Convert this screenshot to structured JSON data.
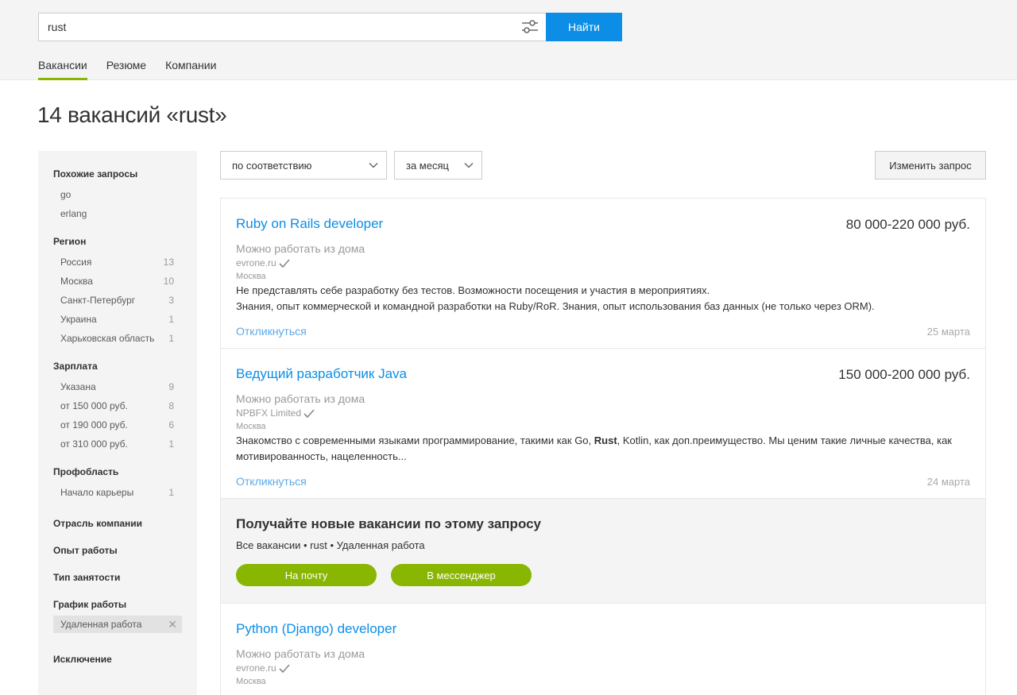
{
  "search": {
    "value": "rust",
    "button_label": "Найти"
  },
  "tabs": [
    {
      "label": "Вакансии",
      "active": true
    },
    {
      "label": "Резюме"
    },
    {
      "label": "Компании"
    }
  ],
  "page_title": "14 вакансий «rust»",
  "sidebar": {
    "similar": {
      "heading": "Похожие запросы",
      "items": [
        {
          "label": "go"
        },
        {
          "label": "erlang"
        }
      ]
    },
    "region": {
      "heading": "Регион",
      "items": [
        {
          "label": "Россия",
          "count": "13"
        },
        {
          "label": "Москва",
          "count": "10"
        },
        {
          "label": "Санкт-Петербург",
          "count": "3"
        },
        {
          "label": "Украина",
          "count": "1"
        },
        {
          "label": "Харьковская область",
          "count": "1"
        }
      ]
    },
    "salary": {
      "heading": "Зарплата",
      "items": [
        {
          "label": "Указана",
          "count": "9"
        },
        {
          "label": "от 150 000 руб.",
          "count": "8"
        },
        {
          "label": "от 190 000 руб.",
          "count": "6"
        },
        {
          "label": "от 310 000 руб.",
          "count": "1"
        }
      ]
    },
    "prof": {
      "heading": "Профобласть",
      "items": [
        {
          "label": "Начало карьеры",
          "count": "1"
        }
      ]
    },
    "industry": {
      "heading": "Отрасль компании"
    },
    "experience": {
      "heading": "Опыт работы"
    },
    "employment": {
      "heading": "Тип занятости"
    },
    "schedule": {
      "heading": "График работы",
      "chip": "Удаленная работа"
    },
    "exclusion": {
      "heading": "Исключение"
    }
  },
  "sort": {
    "order": "по соответствию",
    "period": "за месяц",
    "change_label": "Изменить запрос"
  },
  "vacancies": [
    {
      "title": "Ruby on Rails developer",
      "salary": "80 000-220 000 руб.",
      "remote": "Можно работать из дома",
      "company": "evrone.ru",
      "city": "Москва",
      "desc1": "Не представлять себе разработку без тестов. Возможности посещения и участия в мероприятиях.",
      "desc2": "Знания, опыт коммерческой и командной разработки на Ruby/RoR. Знания, опыт использования баз данных (не только через ORM).",
      "respond": "Откликнуться",
      "date": "25 марта"
    },
    {
      "title": "Ведущий разработчик Java",
      "salary": "150 000-200 000 руб.",
      "remote": "Можно работать из дома",
      "company": "NPBFX Limited",
      "city": "Москва",
      "desc_a": "Знакомство с современными языками программирование, такими как Go, ",
      "desc_bold": "Rust",
      "desc_b": ", Kotlin, как доп.преимущество. Мы ценим такие личные качества, как мотивированность, нацеленность...",
      "respond": "Откликнуться",
      "date": "24 марта"
    },
    {
      "title": "Python (Django) developer",
      "remote": "Можно работать из дома",
      "company": "evrone.ru",
      "city": "Москва"
    }
  ],
  "promo": {
    "title": "Получайте новые вакансии по этому запросу",
    "subtitle": "Все вакансии • rust • Удаленная работа",
    "email_btn": "На почту",
    "messenger_btn": "В мессенджер"
  },
  "colors": {
    "accent_blue": "#0c8ee6",
    "accent_green": "#89b600"
  }
}
